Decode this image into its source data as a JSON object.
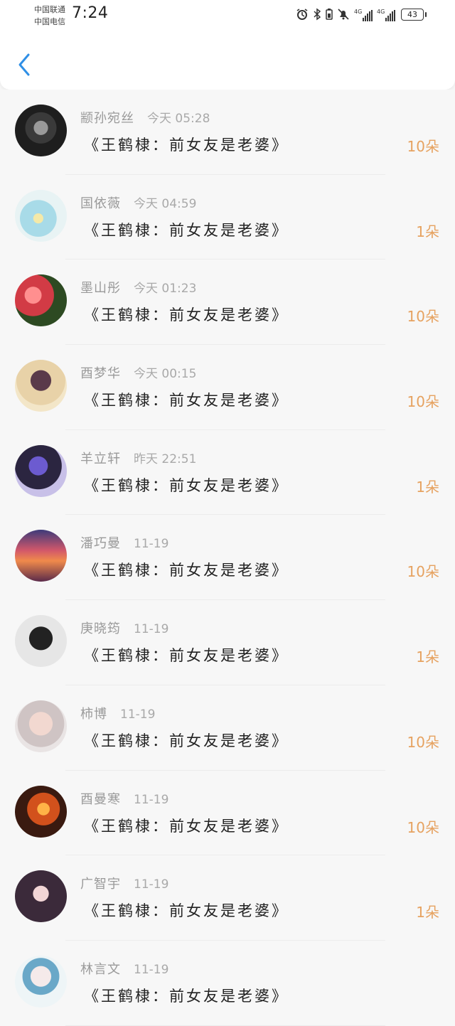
{
  "status_bar": {
    "carrier1": "中国联通",
    "carrier2": "中国电信",
    "time": "7:24",
    "net1": "4G",
    "net2": "4G",
    "battery": "43"
  },
  "header": {
    "back_icon": "chevron-left-icon",
    "accent": "#2f8fe6"
  },
  "amount_color": "#e6a260",
  "items": [
    {
      "name": "颛孙宛丝",
      "time": "今天 05:28",
      "title": "《王鹤棣：前女友是老婆》",
      "amount": "10朵"
    },
    {
      "name": "国依薇",
      "time": "今天 04:59",
      "title": "《王鹤棣：前女友是老婆》",
      "amount": "1朵"
    },
    {
      "name": "墨山彤",
      "time": "今天 01:23",
      "title": "《王鹤棣：前女友是老婆》",
      "amount": "10朵"
    },
    {
      "name": "酉梦华",
      "time": "今天 00:15",
      "title": "《王鹤棣：前女友是老婆》",
      "amount": "10朵"
    },
    {
      "name": "羊立轩",
      "time": "昨天 22:51",
      "title": "《王鹤棣：前女友是老婆》",
      "amount": "1朵"
    },
    {
      "name": "潘巧曼",
      "time": "11-19",
      "title": "《王鹤棣：前女友是老婆》",
      "amount": "10朵"
    },
    {
      "name": "庚晓筠",
      "time": "11-19",
      "title": "《王鹤棣：前女友是老婆》",
      "amount": "1朵"
    },
    {
      "name": "柿博",
      "time": "11-19",
      "title": "《王鹤棣：前女友是老婆》",
      "amount": "10朵"
    },
    {
      "name": "酉曼寒",
      "time": "11-19",
      "title": "《王鹤棣：前女友是老婆》",
      "amount": "10朵"
    },
    {
      "name": "广智宇",
      "time": "11-19",
      "title": "《王鹤棣：前女友是老婆》",
      "amount": "1朵"
    },
    {
      "name": "林言文",
      "time": "11-19",
      "title": "《王鹤棣：前女友是老婆》",
      "amount": ""
    }
  ]
}
